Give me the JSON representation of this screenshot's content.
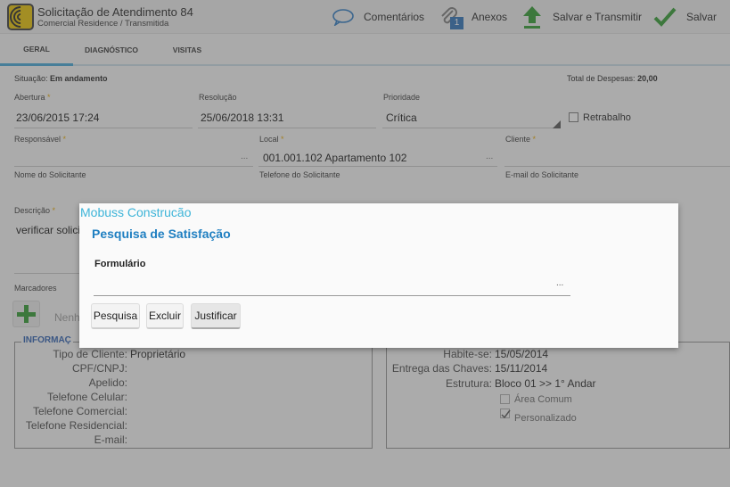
{
  "header": {
    "title": "Solicitação de Atendimento 84",
    "subtitle": "Comercial Residence / Transmitida",
    "actions": [
      {
        "label": "Comentários",
        "icon": "comment-icon"
      },
      {
        "label": "Anexos",
        "icon": "paperclip-icon",
        "badge": "1"
      },
      {
        "label": "Salvar e Transmitir",
        "icon": "upload-arrow-icon"
      },
      {
        "label": "Salvar",
        "icon": "check-icon"
      }
    ]
  },
  "tabs": [
    "GERAL",
    "DIAGNÓSTICO",
    "VISITAS"
  ],
  "form": {
    "situacao_label": "Situação:",
    "situacao_value": "Em andamento",
    "despesas_label": "Total de Despesas:",
    "despesas_value": "20,00",
    "abertura_label": "Abertura",
    "abertura_value": "23/06/2015 17:24",
    "resolucao_label": "Resolução",
    "resolucao_value": "25/06/2018 13:31",
    "prioridade_label": "Prioridade",
    "prioridade_value": "Crítica",
    "retrabalho_label": "Retrabalho",
    "responsavel_label": "Responsável",
    "local_label": "Local",
    "local_value": "001.001.102 Apartamento 102",
    "cliente_label": "Cliente",
    "nome_label": "Nome do Solicitante",
    "telefone_label": "Telefone do Solicitante",
    "email_label": "E-mail do Solicitante",
    "descricao_label": "Descrição",
    "descricao_value": "verificar solicit",
    "marcadores_label": "Marcadores",
    "marcadores_placeholder": "Nenh",
    "dots": "...",
    "req_mark": "*"
  },
  "info_left": {
    "title": "INFORMAÇ",
    "rows": [
      {
        "label": "Tipo de Cliente:",
        "value": "Proprietário"
      },
      {
        "label": "CPF/CNPJ:",
        "value": ""
      },
      {
        "label": "Apelido:",
        "value": ""
      },
      {
        "label": "Telefone Celular:",
        "value": ""
      },
      {
        "label": "Telefone Comercial:",
        "value": ""
      },
      {
        "label": "Telefone Residencial:",
        "value": ""
      },
      {
        "label": "E-mail:",
        "value": ""
      }
    ]
  },
  "info_right": {
    "rows": [
      {
        "label": "Habite-se:",
        "value": "15/05/2014"
      },
      {
        "label": "Entrega das Chaves:",
        "value": "15/11/2014"
      },
      {
        "label": "Estrutura:",
        "value": "Bloco 01 >> 1° Andar"
      }
    ],
    "checks": [
      {
        "label": "Área Comum",
        "checked": false
      },
      {
        "label": "Personalizado",
        "checked": true
      }
    ]
  },
  "dialog": {
    "app_name": "Mobuss Construcão",
    "title": "Pesquisa de Satisfação",
    "field_label": "Formulário",
    "field_dots": "...",
    "buttons": [
      "Pesquisa",
      "Excluir",
      "Justificar"
    ]
  },
  "colors": {
    "accent": "#41a5d6",
    "dialog_title": "#1f7fc1",
    "app_name": "#3db4d8",
    "green": "#2e9a2e"
  }
}
